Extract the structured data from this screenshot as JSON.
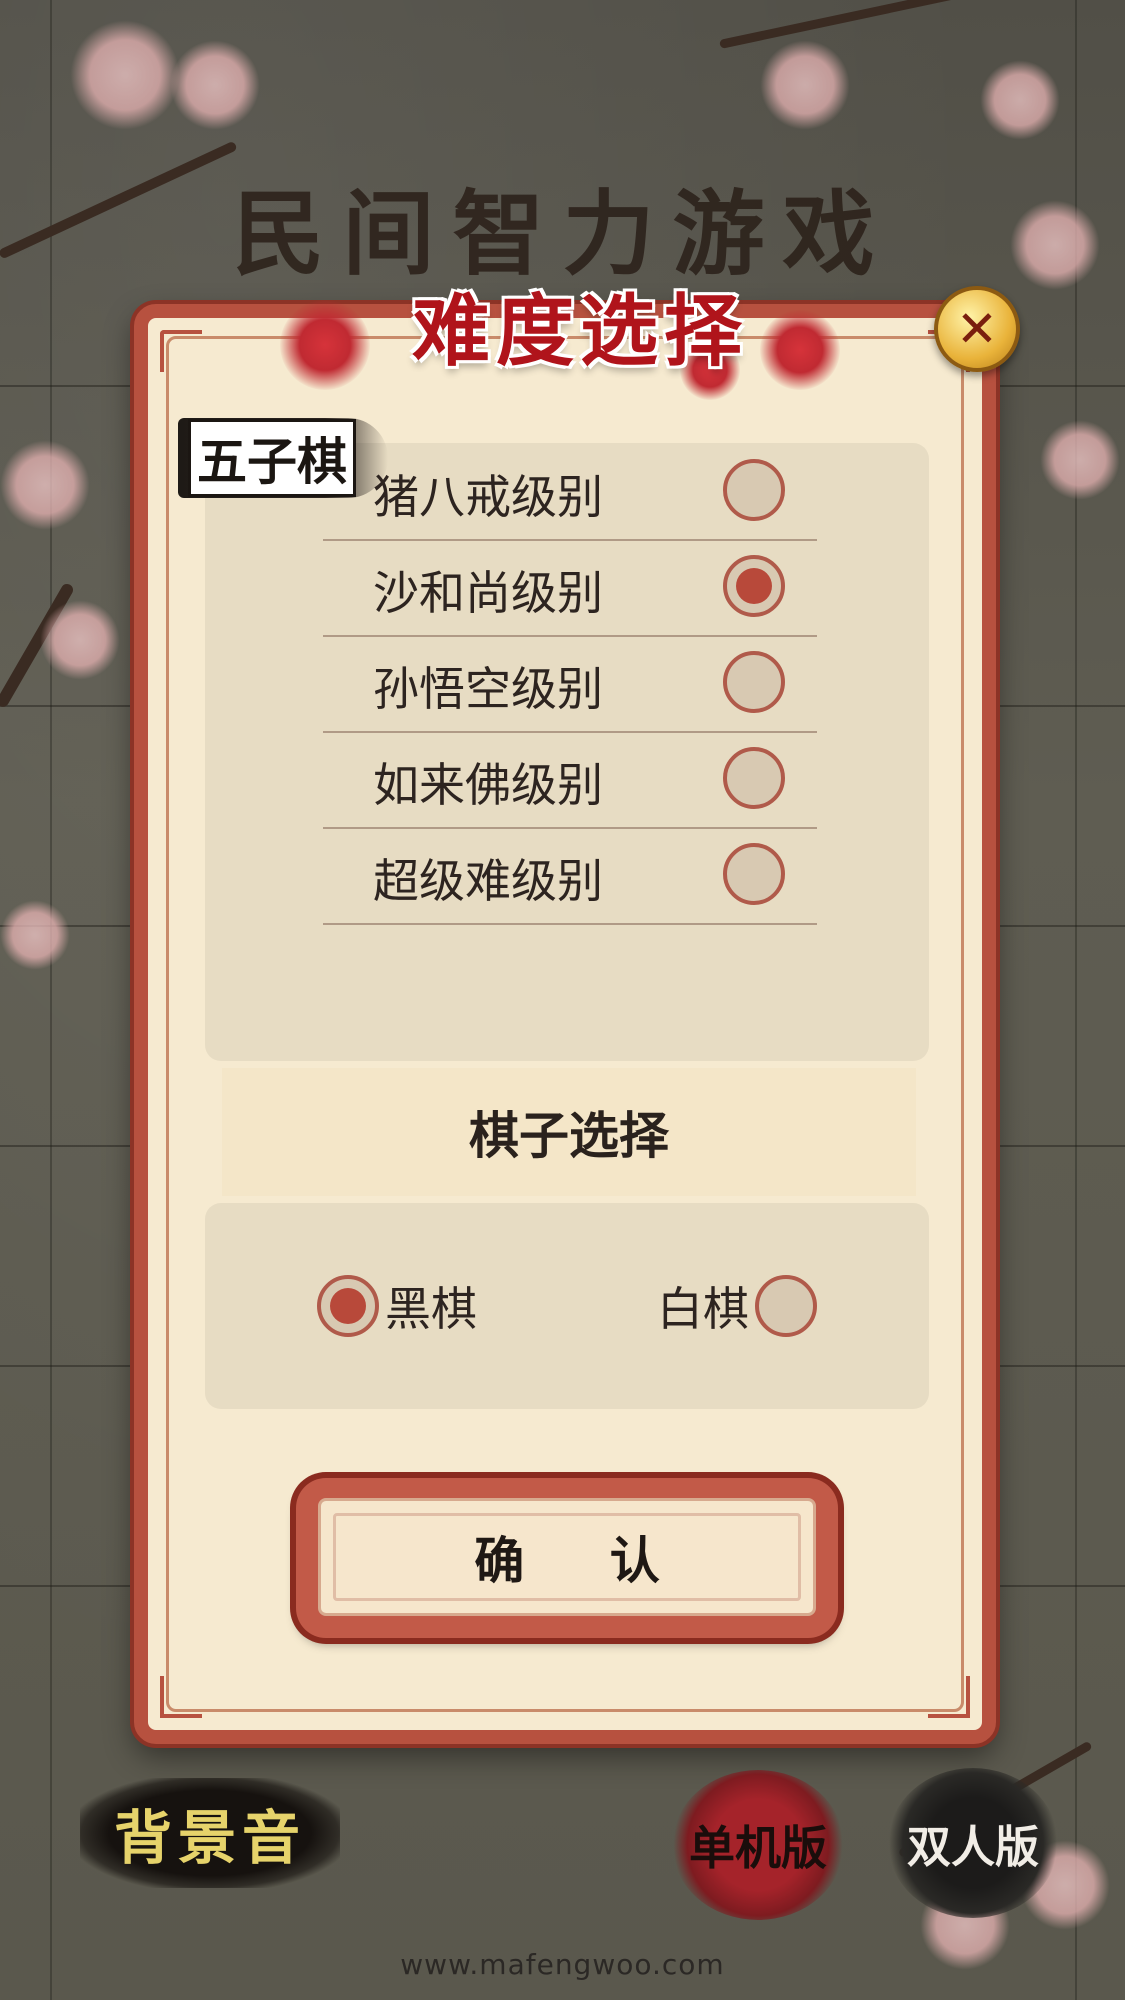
{
  "app": {
    "title": "民间智力游戏",
    "footer_url": "www.mafengwoo.com"
  },
  "dialog": {
    "title": "难度选择",
    "close_icon": "close-icon",
    "game_badge": "五子棋",
    "levels": [
      {
        "label": "猪八戒级别",
        "selected": false
      },
      {
        "label": "沙和尚级别",
        "selected": true
      },
      {
        "label": "孙悟空级别",
        "selected": false
      },
      {
        "label": "如来佛级别",
        "selected": false
      },
      {
        "label": "超级难级别",
        "selected": false
      }
    ],
    "piece_section_title": "棋子选择",
    "pieces": [
      {
        "label": "黑棋",
        "selected": true
      },
      {
        "label": "白棋",
        "selected": false
      }
    ],
    "confirm_label": "确 认"
  },
  "bottom_bar": {
    "bgm_label": "背景音",
    "single_label": "单机版",
    "double_label": "双人版"
  },
  "colors": {
    "accent_red": "#b7513f",
    "panel_bg": "#e7dcc3",
    "dialog_bg": "#f6ead0",
    "title_red": "#b0141b",
    "radio_fill": "#b8493a"
  }
}
